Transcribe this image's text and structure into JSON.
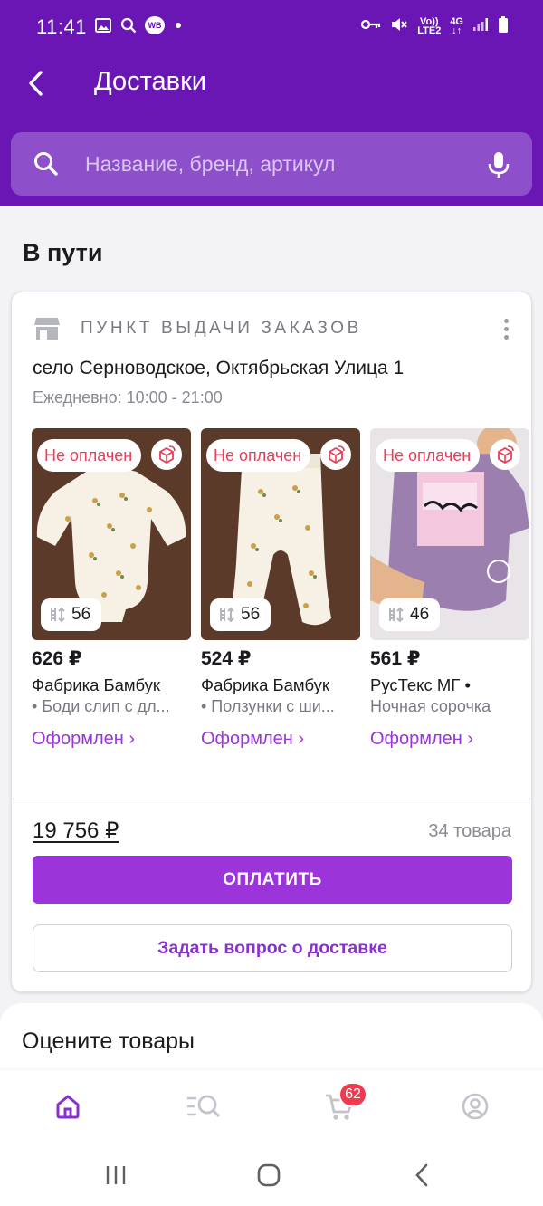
{
  "status_bar": {
    "time": "11:41",
    "left_icons": [
      "image-icon",
      "search-icon",
      "wb-app-icon",
      "dot-icon"
    ],
    "wb_label": "WB",
    "network_label_top": "Vo))",
    "network_label_bottom": "LTE2",
    "network_type": "4G",
    "right_icons": [
      "key-icon",
      "mute-icon",
      "volte-icon",
      "4g-icon",
      "signal-icon",
      "battery-icon"
    ]
  },
  "header": {
    "title": "Доставки",
    "back_icon": "chevron-left-icon"
  },
  "search": {
    "placeholder": "Название, бренд, артикул",
    "icon": "search-icon",
    "mic_icon": "microphone-icon"
  },
  "section": {
    "title": "В пути"
  },
  "order": {
    "pickup_label": "ПУНКТ ВЫДАЧИ ЗАКАЗОВ",
    "address": "село Серноводское, Октябрьская Улица 1",
    "hours": "Ежедневно: 10:00 - 21:00",
    "products": [
      {
        "badge": "Не оплачен",
        "size": "56",
        "price": "626 ₽",
        "brand": "Фабрика Бамбук",
        "name": "• Боди слип с дл...",
        "status": "Оформлен ›",
        "image": "baby bodysuit"
      },
      {
        "badge": "Не оплачен",
        "size": "56",
        "price": "524 ₽",
        "brand": "Фабрика Бамбук",
        "name": "• Ползунки с ши...",
        "status": "Оформлен ›",
        "image": "baby rompers"
      },
      {
        "badge": "Не оплачен",
        "size": "46",
        "price": "561 ₽",
        "brand": "РусТекс МГ •",
        "name": "Ночная сорочка",
        "status": "Оформлен ›",
        "image": "lilac nightgown"
      }
    ],
    "total": "19 756 ₽",
    "count": "34 товара",
    "pay_label": "ОПЛАТИТЬ",
    "ask_label": "Задать вопрос о доставке"
  },
  "rate": {
    "title": "Оцените товары"
  },
  "bottom_nav": {
    "items": [
      "home-icon",
      "catalog-search-icon",
      "cart-icon",
      "profile-icon"
    ],
    "cart_count": "62"
  },
  "colors": {
    "header": "#6a16b4",
    "search_bg": "#8e4fcb",
    "accent": "#9b35d9",
    "unpaid": "#e63f5a",
    "badge": "#f2394f"
  }
}
